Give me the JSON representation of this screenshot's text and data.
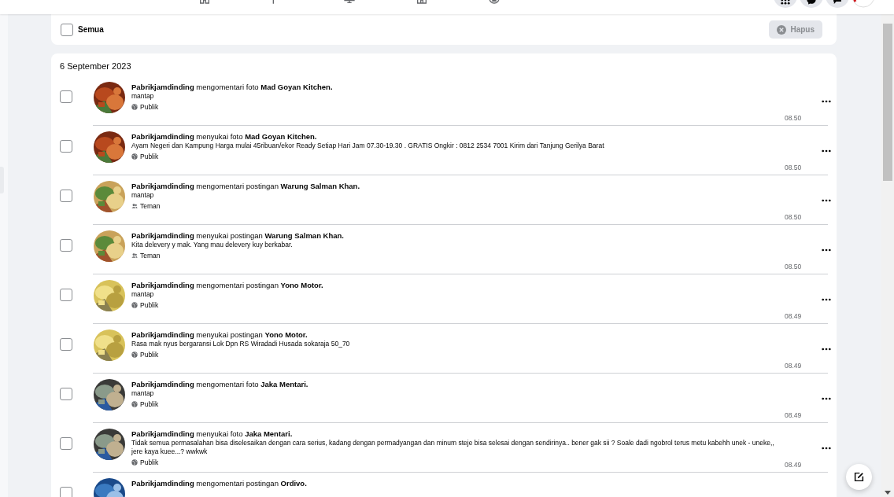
{
  "select_all": {
    "label": "Semua",
    "checked": false
  },
  "delete_button": {
    "label": "Hapus",
    "disabled": true
  },
  "date": "6 September 2023",
  "activities": [
    {
      "text": "**Pabrikjamdinding** mengomentari foto **Mad Goyan Kitchen.**",
      "detail": "mantap",
      "audience": {
        "kind": "public",
        "label": "Publik"
      },
      "time": "08.50",
      "checked": false
    },
    {
      "text": "**Pabrikjamdinding** menyukai foto **Mad Goyan Kitchen.**",
      "detail": "Ayam Negeri dan Kampung Harga mulai 45ribuan/ekor Ready Setiap Hari Jam 07.30-19.30 . GRATIS Ongkir : 0812 2534 7001 Kirim dari Tanjung Gerilya Barat",
      "audience": {
        "kind": "public",
        "label": "Publik"
      },
      "time": "08.50",
      "checked": false
    },
    {
      "text": "**Pabrikjamdinding** mengomentari postingan **Warung Salman Khan.**",
      "detail": "mantap",
      "audience": {
        "kind": "friends",
        "label": "Teman"
      },
      "time": "08.50",
      "checked": false
    },
    {
      "text": "**Pabrikjamdinding** menyukai postingan **Warung Salman Khan.**",
      "detail": "Kita delevery y mak. Yang mau delevery kuy berkabar.",
      "audience": {
        "kind": "friends",
        "label": "Teman"
      },
      "time": "08.50",
      "checked": false
    },
    {
      "text": "**Pabrikjamdinding** mengomentari postingan **Yono Motor.**",
      "detail": "mantap",
      "audience": {
        "kind": "public",
        "label": "Publik"
      },
      "time": "08.49",
      "checked": false
    },
    {
      "text": "**Pabrikjamdinding** menyukai postingan **Yono Motor.**",
      "detail": "Rasa mak nyus bergaransi Lok Dpn RS Wiradadi Husada sokaraja 50_70",
      "audience": {
        "kind": "public",
        "label": "Publik"
      },
      "time": "08.49",
      "checked": false
    },
    {
      "text": "**Pabrikjamdinding** mengomentari foto **Jaka Mentari.**",
      "detail": "mantap",
      "audience": {
        "kind": "public",
        "label": "Publik"
      },
      "time": "08.49",
      "checked": false
    },
    {
      "text": "**Pabrikjamdinding** menyukai foto **Jaka Mentari.**",
      "detail": "Tidak semua permasalahan bisa diselesaikan dengan cara serius, kadang dengan permadyangan dan minum steje bisa selesai dengan sendirinya.. bener gak sii ? Soale dadi ngobrol terus metu kabehh unek - uneke,, jere kaya kuee...? wwkwk",
      "audience": {
        "kind": "public",
        "label": "Publik"
      },
      "time": "08.49",
      "checked": false
    },
    {
      "text": "**Pabrikjamdinding** mengomentari postingan **Ordivo.**",
      "checked": false
    }
  ]
}
